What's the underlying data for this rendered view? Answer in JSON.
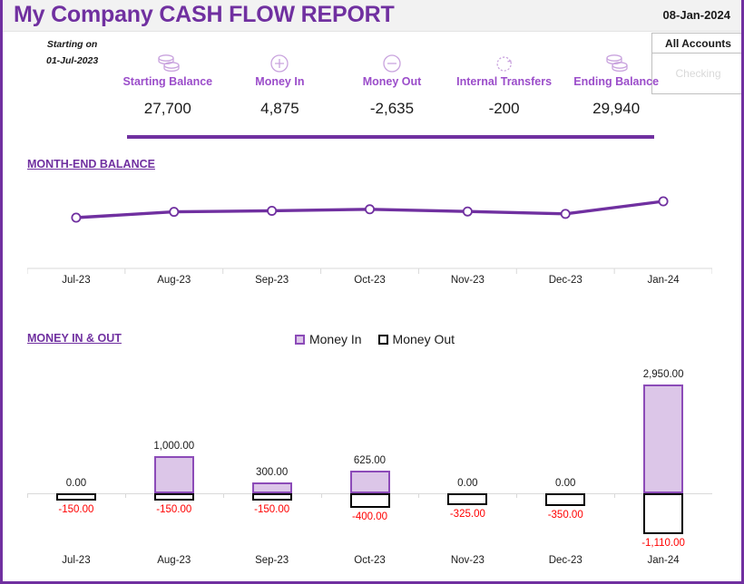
{
  "header": {
    "title": "My Company CASH FLOW REPORT",
    "date": "08-Jan-2024"
  },
  "starting": {
    "label": "Starting on",
    "date": "01-Jul-2023"
  },
  "slicer": {
    "header": "All Accounts",
    "item": "Checking"
  },
  "kpis": [
    {
      "icon": "coins-stack-icon",
      "label": "Starting Balance",
      "value": "27,700"
    },
    {
      "icon": "plus-circle-icon",
      "label": "Money In",
      "value": "4,875"
    },
    {
      "icon": "minus-circle-icon",
      "label": "Money Out",
      "value": "-2,635"
    },
    {
      "icon": "transfer-arrows-icon",
      "label": "Internal Transfers",
      "value": "-200"
    },
    {
      "icon": "coins-stack-icon",
      "label": "Ending Balance",
      "value": "29,940"
    }
  ],
  "sections": {
    "balance": "MONTH-END BALANCE",
    "money": "MONEY IN & OUT"
  },
  "legend": [
    {
      "name": "Money In"
    },
    {
      "name": "Money Out"
    }
  ],
  "colors": {
    "brand_purple": "#7030A0",
    "label_purple": "#9B4DCA",
    "bar_fill": "#DCC6E8",
    "bar_border": "#8C4BB8",
    "negative_red": "#FF0000",
    "header_band": "#F2F2F2"
  },
  "chart_data": [
    {
      "type": "line",
      "title": "MONTH-END BALANCE",
      "categories": [
        "Jul-23",
        "Aug-23",
        "Sep-23",
        "Oct-23",
        "Nov-23",
        "Dec-23",
        "Jan-24"
      ],
      "values": [
        27550,
        28400,
        28550,
        28775,
        28450,
        28100,
        29940
      ],
      "xlabel": "",
      "ylabel": "",
      "grid": false,
      "legend": "none",
      "marker": "circle-open"
    },
    {
      "type": "bar",
      "title": "MONEY IN & OUT",
      "categories": [
        "Jul-23",
        "Aug-23",
        "Sep-23",
        "Oct-23",
        "Nov-23",
        "Dec-23",
        "Jan-24"
      ],
      "series": [
        {
          "name": "Money In",
          "values": [
            0,
            1000,
            300,
            625,
            0,
            0,
            2950
          ],
          "labels": [
            "0.00",
            "1,000.00",
            "300.00",
            "625.00",
            "0.00",
            "0.00",
            "2,950.00"
          ]
        },
        {
          "name": "Money Out",
          "values": [
            -150,
            -150,
            -150,
            -400,
            -325,
            -350,
            -1110
          ],
          "labels": [
            "-150.00",
            "-150.00",
            "-150.00",
            "-400.00",
            "-325.00",
            "-350.00",
            "-1,110.00"
          ]
        }
      ],
      "xlabel": "",
      "ylabel": "",
      "grid": false,
      "legend": "top-center"
    }
  ]
}
